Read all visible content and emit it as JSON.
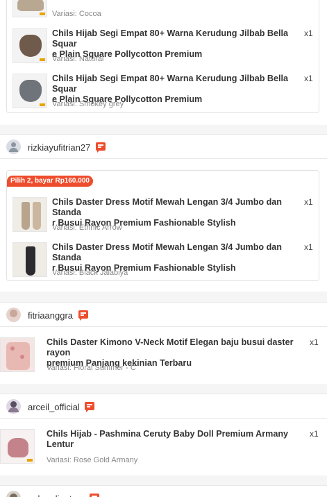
{
  "order1": {
    "items": [
      {
        "variant": "Variasi: Cocoa"
      },
      {
        "title_line1": "Chils Hijab Segi Empat 80+ Warna Kerudung Jilbab Bella Squar",
        "title_line2": "e Plain Square Pollycotton Premium",
        "variant": "Variasi: Natural",
        "qty": "x1"
      },
      {
        "title_line1": "Chils Hijab Segi Empat 80+ Warna Kerudung Jilbab Bella Squar",
        "title_line2": "e Plain Square Pollycotton Premium",
        "variant": "Variasi: Smokey grey",
        "qty": "x1"
      }
    ]
  },
  "order2": {
    "seller": "rizkiayufitrian27",
    "promo": "Pilih 2, bayar Rp160.000",
    "items": [
      {
        "title_line1": "Chils Daster Dress Motif Mewah Lengan 3/4 Jumbo dan Standa",
        "title_line2": "r Busui Rayon Premium Fashionable Stylish",
        "variant": "Variasi: Ethnic Arrow",
        "qty": "x1"
      },
      {
        "title_line1": "Chils Daster Dress Motif Mewah Lengan 3/4 Jumbo dan Standa",
        "title_line2": "r Busui Rayon Premium Fashionable Stylish",
        "variant": "Variasi: Black Jalabiya",
        "qty": "x1"
      }
    ]
  },
  "order3": {
    "seller": "fitriaanggra",
    "items": [
      {
        "title_line1": "Chils Daster Kimono V-Neck Motif Elegan baju busui daster rayon",
        "title_line2": "premium Panjang kekinian Terbaru",
        "variant": "Variasi: Floral Summer - C",
        "qty": "x1"
      }
    ]
  },
  "order4": {
    "seller": "arceil_official",
    "items": [
      {
        "title_line1": "Chils Hijab - Pashmina Ceruty Baby Doll Premium Armany Lentur",
        "variant": "Variasi: Rose Gold Armany",
        "qty": "x1"
      }
    ]
  },
  "order5": {
    "seller": "gokuadienta"
  },
  "colors": {
    "accent": "#ee4d2d",
    "price_tag": "#e9a400"
  }
}
